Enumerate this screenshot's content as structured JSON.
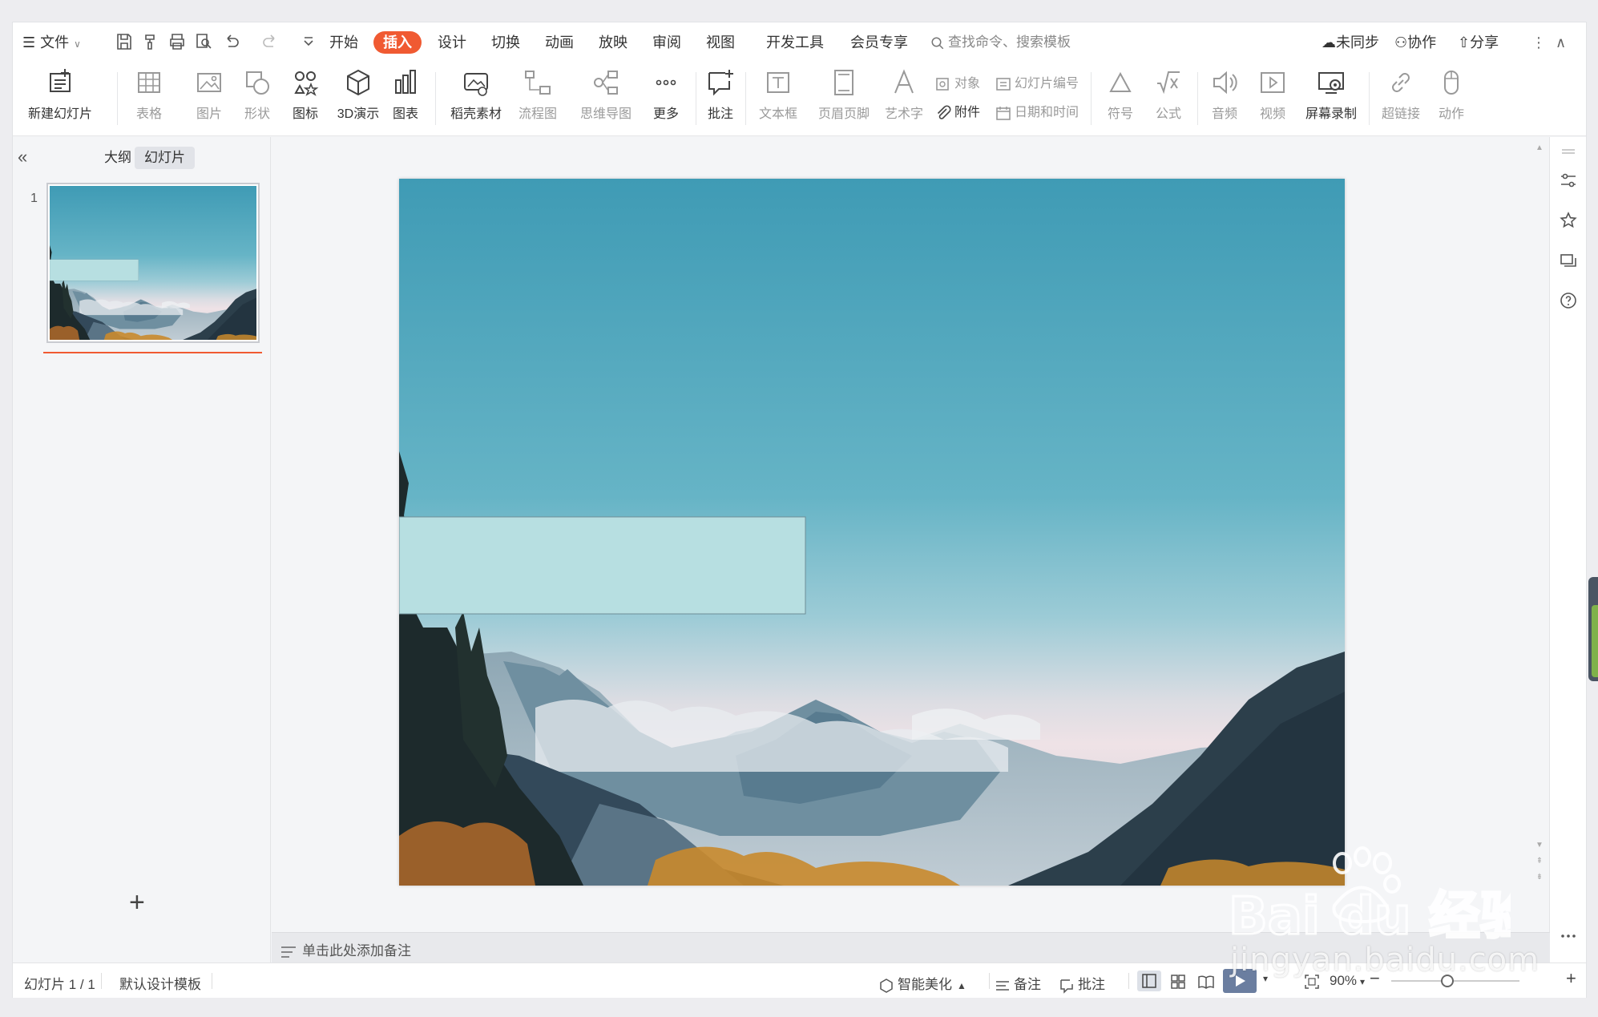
{
  "menubar": {
    "file": "文件",
    "tabs": [
      "开始",
      "插入",
      "设计",
      "切换",
      "动画",
      "放映",
      "审阅",
      "视图",
      "开发工具",
      "会员专享"
    ],
    "active_tab": "插入",
    "search_placeholder": "查找命令、搜索模板",
    "unsynced": "未同步",
    "collaborate": "协作",
    "share": "分享"
  },
  "ribbon": {
    "new_slide": "新建幻灯片",
    "table": "表格",
    "picture": "图片",
    "shape": "形状",
    "icon": "图标",
    "three_d": "3D演示",
    "chart": "图表",
    "materials": "稻壳素材",
    "flowchart": "流程图",
    "mindmap": "思维导图",
    "more": "更多",
    "comment": "批注",
    "textbox": "文本框",
    "header_footer": "页眉页脚",
    "wordart": "艺术字",
    "object": "对象",
    "slide_number": "幻灯片编号",
    "attachment": "附件",
    "date_time": "日期和时间",
    "symbol": "符号",
    "formula": "公式",
    "audio": "音频",
    "video": "视频",
    "screen_record": "屏幕录制",
    "hyperlink": "超链接",
    "action": "动作"
  },
  "leftpanel": {
    "tab_outline": "大纲",
    "tab_slides": "幻灯片",
    "slide_number": "1",
    "add_label": "+"
  },
  "notes": {
    "placeholder": "单击此处添加备注"
  },
  "statusbar": {
    "slide_info": "幻灯片 1 / 1",
    "template": "默认设计模板",
    "beautify": "智能美化",
    "notes": "备注",
    "comments": "批注",
    "zoom": "90%",
    "zoom_fraction": 0.44
  },
  "watermark": {
    "text": "jingyan.baidu.com"
  },
  "colors": {
    "accent": "#f05a32",
    "sky_top": "#3f9bb5",
    "rect_fill": "#b7dfe1"
  }
}
